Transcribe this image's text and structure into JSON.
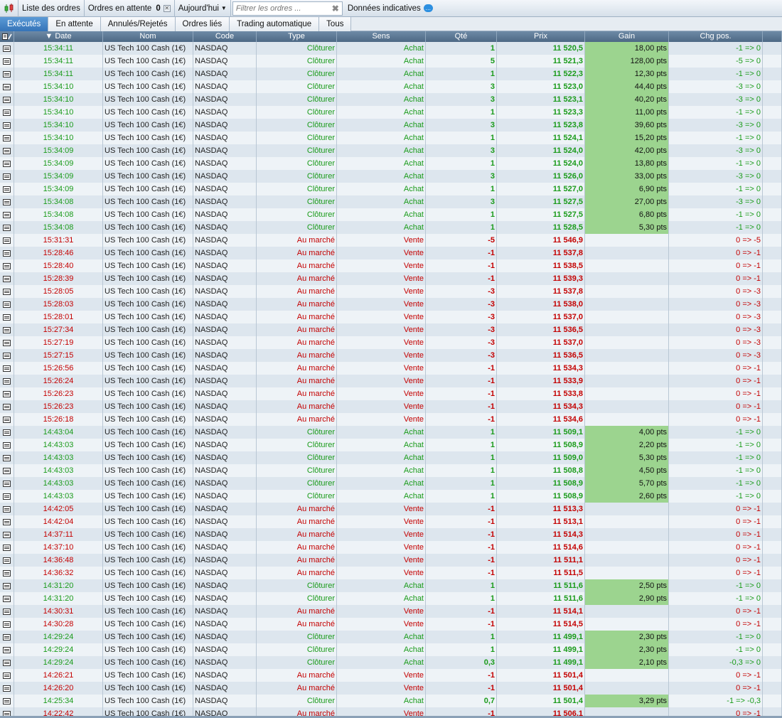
{
  "toolbar": {
    "order_list_label": "Liste des ordres",
    "pending_label": "Ordres en attente",
    "pending_count": "0",
    "period_label": "Aujourd'hui",
    "filter_placeholder": "Filtrer les ordres ...",
    "info_label": "Données indicatives"
  },
  "tabs": [
    "Exécutés",
    "En attente",
    "Annulés/Rejetés",
    "Ordres liés",
    "Trading automatique",
    "Tous"
  ],
  "columns": [
    "Date",
    "Nom",
    "Code",
    "Type",
    "Sens",
    "Qté",
    "Prix",
    "Gain",
    "Chg pos."
  ],
  "colors": {
    "buy": "#1a9b1a",
    "sell": "#c40000",
    "gain_bg": "#9cd48f",
    "active_tab": "#3574b8"
  },
  "rows": [
    {
      "date": "15:34:11",
      "name": "US Tech 100 Cash (1€)",
      "code": "NASDAQ",
      "type": "Clôturer",
      "side": "Achat",
      "qty": "1",
      "price": "11 520,5",
      "gain": "18,00 pts",
      "chg": "-1 => 0"
    },
    {
      "date": "15:34:11",
      "name": "US Tech 100 Cash (1€)",
      "code": "NASDAQ",
      "type": "Clôturer",
      "side": "Achat",
      "qty": "5",
      "price": "11 521,3",
      "gain": "128,00 pts",
      "chg": "-5 => 0"
    },
    {
      "date": "15:34:11",
      "name": "US Tech 100 Cash (1€)",
      "code": "NASDAQ",
      "type": "Clôturer",
      "side": "Achat",
      "qty": "1",
      "price": "11 522,3",
      "gain": "12,30 pts",
      "chg": "-1 => 0"
    },
    {
      "date": "15:34:10",
      "name": "US Tech 100 Cash (1€)",
      "code": "NASDAQ",
      "type": "Clôturer",
      "side": "Achat",
      "qty": "3",
      "price": "11 523,0",
      "gain": "44,40 pts",
      "chg": "-3 => 0"
    },
    {
      "date": "15:34:10",
      "name": "US Tech 100 Cash (1€)",
      "code": "NASDAQ",
      "type": "Clôturer",
      "side": "Achat",
      "qty": "3",
      "price": "11 523,1",
      "gain": "40,20 pts",
      "chg": "-3 => 0"
    },
    {
      "date": "15:34:10",
      "name": "US Tech 100 Cash (1€)",
      "code": "NASDAQ",
      "type": "Clôturer",
      "side": "Achat",
      "qty": "1",
      "price": "11 523,3",
      "gain": "11,00 pts",
      "chg": "-1 => 0"
    },
    {
      "date": "15:34:10",
      "name": "US Tech 100 Cash (1€)",
      "code": "NASDAQ",
      "type": "Clôturer",
      "side": "Achat",
      "qty": "3",
      "price": "11 523,8",
      "gain": "39,60 pts",
      "chg": "-3 => 0"
    },
    {
      "date": "15:34:10",
      "name": "US Tech 100 Cash (1€)",
      "code": "NASDAQ",
      "type": "Clôturer",
      "side": "Achat",
      "qty": "1",
      "price": "11 524,1",
      "gain": "15,20 pts",
      "chg": "-1 => 0"
    },
    {
      "date": "15:34:09",
      "name": "US Tech 100 Cash (1€)",
      "code": "NASDAQ",
      "type": "Clôturer",
      "side": "Achat",
      "qty": "3",
      "price": "11 524,0",
      "gain": "42,00 pts",
      "chg": "-3 => 0"
    },
    {
      "date": "15:34:09",
      "name": "US Tech 100 Cash (1€)",
      "code": "NASDAQ",
      "type": "Clôturer",
      "side": "Achat",
      "qty": "1",
      "price": "11 524,0",
      "gain": "13,80 pts",
      "chg": "-1 => 0"
    },
    {
      "date": "15:34:09",
      "name": "US Tech 100 Cash (1€)",
      "code": "NASDAQ",
      "type": "Clôturer",
      "side": "Achat",
      "qty": "3",
      "price": "11 526,0",
      "gain": "33,00 pts",
      "chg": "-3 => 0"
    },
    {
      "date": "15:34:09",
      "name": "US Tech 100 Cash (1€)",
      "code": "NASDAQ",
      "type": "Clôturer",
      "side": "Achat",
      "qty": "1",
      "price": "11 527,0",
      "gain": "6,90 pts",
      "chg": "-1 => 0"
    },
    {
      "date": "15:34:08",
      "name": "US Tech 100 Cash (1€)",
      "code": "NASDAQ",
      "type": "Clôturer",
      "side": "Achat",
      "qty": "3",
      "price": "11 527,5",
      "gain": "27,00 pts",
      "chg": "-3 => 0"
    },
    {
      "date": "15:34:08",
      "name": "US Tech 100 Cash (1€)",
      "code": "NASDAQ",
      "type": "Clôturer",
      "side": "Achat",
      "qty": "1",
      "price": "11 527,5",
      "gain": "6,80 pts",
      "chg": "-1 => 0"
    },
    {
      "date": "15:34:08",
      "name": "US Tech 100 Cash (1€)",
      "code": "NASDAQ",
      "type": "Clôturer",
      "side": "Achat",
      "qty": "1",
      "price": "11 528,5",
      "gain": "5,30 pts",
      "chg": "-1 => 0"
    },
    {
      "date": "15:31:31",
      "name": "US Tech 100 Cash (1€)",
      "code": "NASDAQ",
      "type": "Au marché",
      "side": "Vente",
      "qty": "-5",
      "price": "11 546,9",
      "gain": "",
      "chg": "0 => -5"
    },
    {
      "date": "15:28:46",
      "name": "US Tech 100 Cash (1€)",
      "code": "NASDAQ",
      "type": "Au marché",
      "side": "Vente",
      "qty": "-1",
      "price": "11 537,8",
      "gain": "",
      "chg": "0 => -1"
    },
    {
      "date": "15:28:40",
      "name": "US Tech 100 Cash (1€)",
      "code": "NASDAQ",
      "type": "Au marché",
      "side": "Vente",
      "qty": "-1",
      "price": "11 538,5",
      "gain": "",
      "chg": "0 => -1"
    },
    {
      "date": "15:28:39",
      "name": "US Tech 100 Cash (1€)",
      "code": "NASDAQ",
      "type": "Au marché",
      "side": "Vente",
      "qty": "-1",
      "price": "11 539,3",
      "gain": "",
      "chg": "0 => -1"
    },
    {
      "date": "15:28:05",
      "name": "US Tech 100 Cash (1€)",
      "code": "NASDAQ",
      "type": "Au marché",
      "side": "Vente",
      "qty": "-3",
      "price": "11 537,8",
      "gain": "",
      "chg": "0 => -3"
    },
    {
      "date": "15:28:03",
      "name": "US Tech 100 Cash (1€)",
      "code": "NASDAQ",
      "type": "Au marché",
      "side": "Vente",
      "qty": "-3",
      "price": "11 538,0",
      "gain": "",
      "chg": "0 => -3"
    },
    {
      "date": "15:28:01",
      "name": "US Tech 100 Cash (1€)",
      "code": "NASDAQ",
      "type": "Au marché",
      "side": "Vente",
      "qty": "-3",
      "price": "11 537,0",
      "gain": "",
      "chg": "0 => -3"
    },
    {
      "date": "15:27:34",
      "name": "US Tech 100 Cash (1€)",
      "code": "NASDAQ",
      "type": "Au marché",
      "side": "Vente",
      "qty": "-3",
      "price": "11 536,5",
      "gain": "",
      "chg": "0 => -3"
    },
    {
      "date": "15:27:19",
      "name": "US Tech 100 Cash (1€)",
      "code": "NASDAQ",
      "type": "Au marché",
      "side": "Vente",
      "qty": "-3",
      "price": "11 537,0",
      "gain": "",
      "chg": "0 => -3"
    },
    {
      "date": "15:27:15",
      "name": "US Tech 100 Cash (1€)",
      "code": "NASDAQ",
      "type": "Au marché",
      "side": "Vente",
      "qty": "-3",
      "price": "11 536,5",
      "gain": "",
      "chg": "0 => -3"
    },
    {
      "date": "15:26:56",
      "name": "US Tech 100 Cash (1€)",
      "code": "NASDAQ",
      "type": "Au marché",
      "side": "Vente",
      "qty": "-1",
      "price": "11 534,3",
      "gain": "",
      "chg": "0 => -1"
    },
    {
      "date": "15:26:24",
      "name": "US Tech 100 Cash (1€)",
      "code": "NASDAQ",
      "type": "Au marché",
      "side": "Vente",
      "qty": "-1",
      "price": "11 533,9",
      "gain": "",
      "chg": "0 => -1"
    },
    {
      "date": "15:26:23",
      "name": "US Tech 100 Cash (1€)",
      "code": "NASDAQ",
      "type": "Au marché",
      "side": "Vente",
      "qty": "-1",
      "price": "11 533,8",
      "gain": "",
      "chg": "0 => -1"
    },
    {
      "date": "15:26:23",
      "name": "US Tech 100 Cash (1€)",
      "code": "NASDAQ",
      "type": "Au marché",
      "side": "Vente",
      "qty": "-1",
      "price": "11 534,3",
      "gain": "",
      "chg": "0 => -1"
    },
    {
      "date": "15:26:18",
      "name": "US Tech 100 Cash (1€)",
      "code": "NASDAQ",
      "type": "Au marché",
      "side": "Vente",
      "qty": "-1",
      "price": "11 534,6",
      "gain": "",
      "chg": "0 => -1"
    },
    {
      "date": "14:43:04",
      "name": "US Tech 100 Cash (1€)",
      "code": "NASDAQ",
      "type": "Clôturer",
      "side": "Achat",
      "qty": "1",
      "price": "11 509,1",
      "gain": "4,00 pts",
      "chg": "-1 => 0"
    },
    {
      "date": "14:43:03",
      "name": "US Tech 100 Cash (1€)",
      "code": "NASDAQ",
      "type": "Clôturer",
      "side": "Achat",
      "qty": "1",
      "price": "11 508,9",
      "gain": "2,20 pts",
      "chg": "-1 => 0"
    },
    {
      "date": "14:43:03",
      "name": "US Tech 100 Cash (1€)",
      "code": "NASDAQ",
      "type": "Clôturer",
      "side": "Achat",
      "qty": "1",
      "price": "11 509,0",
      "gain": "5,30 pts",
      "chg": "-1 => 0"
    },
    {
      "date": "14:43:03",
      "name": "US Tech 100 Cash (1€)",
      "code": "NASDAQ",
      "type": "Clôturer",
      "side": "Achat",
      "qty": "1",
      "price": "11 508,8",
      "gain": "4,50 pts",
      "chg": "-1 => 0"
    },
    {
      "date": "14:43:03",
      "name": "US Tech 100 Cash (1€)",
      "code": "NASDAQ",
      "type": "Clôturer",
      "side": "Achat",
      "qty": "1",
      "price": "11 508,9",
      "gain": "5,70 pts",
      "chg": "-1 => 0"
    },
    {
      "date": "14:43:03",
      "name": "US Tech 100 Cash (1€)",
      "code": "NASDAQ",
      "type": "Clôturer",
      "side": "Achat",
      "qty": "1",
      "price": "11 508,9",
      "gain": "2,60 pts",
      "chg": "-1 => 0"
    },
    {
      "date": "14:42:05",
      "name": "US Tech 100 Cash (1€)",
      "code": "NASDAQ",
      "type": "Au marché",
      "side": "Vente",
      "qty": "-1",
      "price": "11 513,3",
      "gain": "",
      "chg": "0 => -1"
    },
    {
      "date": "14:42:04",
      "name": "US Tech 100 Cash (1€)",
      "code": "NASDAQ",
      "type": "Au marché",
      "side": "Vente",
      "qty": "-1",
      "price": "11 513,1",
      "gain": "",
      "chg": "0 => -1"
    },
    {
      "date": "14:37:11",
      "name": "US Tech 100 Cash (1€)",
      "code": "NASDAQ",
      "type": "Au marché",
      "side": "Vente",
      "qty": "-1",
      "price": "11 514,3",
      "gain": "",
      "chg": "0 => -1"
    },
    {
      "date": "14:37:10",
      "name": "US Tech 100 Cash (1€)",
      "code": "NASDAQ",
      "type": "Au marché",
      "side": "Vente",
      "qty": "-1",
      "price": "11 514,6",
      "gain": "",
      "chg": "0 => -1"
    },
    {
      "date": "14:36:48",
      "name": "US Tech 100 Cash (1€)",
      "code": "NASDAQ",
      "type": "Au marché",
      "side": "Vente",
      "qty": "-1",
      "price": "11 511,1",
      "gain": "",
      "chg": "0 => -1"
    },
    {
      "date": "14:36:32",
      "name": "US Tech 100 Cash (1€)",
      "code": "NASDAQ",
      "type": "Au marché",
      "side": "Vente",
      "qty": "-1",
      "price": "11 511,5",
      "gain": "",
      "chg": "0 => -1"
    },
    {
      "date": "14:31:20",
      "name": "US Tech 100 Cash (1€)",
      "code": "NASDAQ",
      "type": "Clôturer",
      "side": "Achat",
      "qty": "1",
      "price": "11 511,6",
      "gain": "2,50 pts",
      "chg": "-1 => 0"
    },
    {
      "date": "14:31:20",
      "name": "US Tech 100 Cash (1€)",
      "code": "NASDAQ",
      "type": "Clôturer",
      "side": "Achat",
      "qty": "1",
      "price": "11 511,6",
      "gain": "2,90 pts",
      "chg": "-1 => 0"
    },
    {
      "date": "14:30:31",
      "name": "US Tech 100 Cash (1€)",
      "code": "NASDAQ",
      "type": "Au marché",
      "side": "Vente",
      "qty": "-1",
      "price": "11 514,1",
      "gain": "",
      "chg": "0 => -1"
    },
    {
      "date": "14:30:28",
      "name": "US Tech 100 Cash (1€)",
      "code": "NASDAQ",
      "type": "Au marché",
      "side": "Vente",
      "qty": "-1",
      "price": "11 514,5",
      "gain": "",
      "chg": "0 => -1"
    },
    {
      "date": "14:29:24",
      "name": "US Tech 100 Cash (1€)",
      "code": "NASDAQ",
      "type": "Clôturer",
      "side": "Achat",
      "qty": "1",
      "price": "11 499,1",
      "gain": "2,30 pts",
      "chg": "-1 => 0"
    },
    {
      "date": "14:29:24",
      "name": "US Tech 100 Cash (1€)",
      "code": "NASDAQ",
      "type": "Clôturer",
      "side": "Achat",
      "qty": "1",
      "price": "11 499,1",
      "gain": "2,30 pts",
      "chg": "-1 => 0"
    },
    {
      "date": "14:29:24",
      "name": "US Tech 100 Cash (1€)",
      "code": "NASDAQ",
      "type": "Clôturer",
      "side": "Achat",
      "qty": "0,3",
      "price": "11 499,1",
      "gain": "2,10 pts",
      "chg": "-0,3 => 0"
    },
    {
      "date": "14:26:21",
      "name": "US Tech 100 Cash (1€)",
      "code": "NASDAQ",
      "type": "Au marché",
      "side": "Vente",
      "qty": "-1",
      "price": "11 501,4",
      "gain": "",
      "chg": "0 => -1"
    },
    {
      "date": "14:26:20",
      "name": "US Tech 100 Cash (1€)",
      "code": "NASDAQ",
      "type": "Au marché",
      "side": "Vente",
      "qty": "-1",
      "price": "11 501,4",
      "gain": "",
      "chg": "0 => -1"
    },
    {
      "date": "14:25:34",
      "name": "US Tech 100 Cash (1€)",
      "code": "NASDAQ",
      "type": "Clôturer",
      "side": "Achat",
      "qty": "0,7",
      "price": "11 501,4",
      "gain": "3,29 pts",
      "chg": "-1 => -0,3"
    },
    {
      "date": "14:22:42",
      "name": "US Tech 100 Cash (1€)",
      "code": "NASDAQ",
      "type": "Au marché",
      "side": "Vente",
      "qty": "-1",
      "price": "11 506,1",
      "gain": "",
      "chg": "0 => -1"
    }
  ]
}
